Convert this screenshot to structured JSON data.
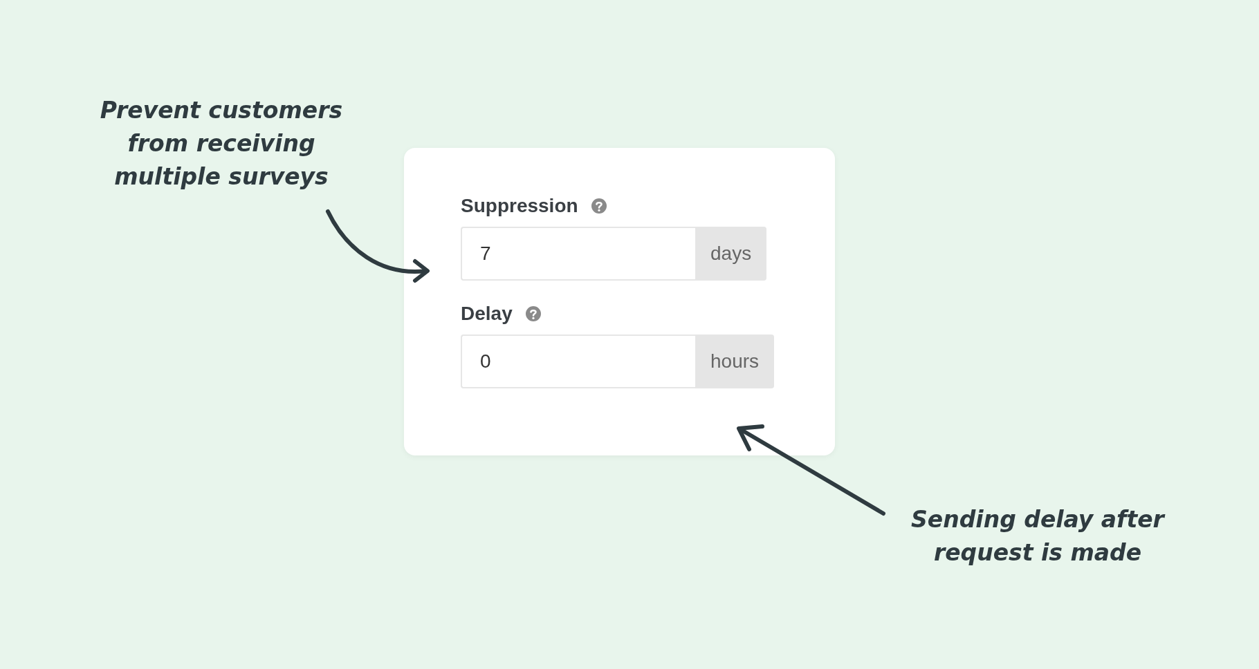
{
  "annotations": [
    {
      "lines": [
        "Prevent customers",
        "from receiving",
        "multiple surveys"
      ]
    },
    {
      "lines": [
        "Sending delay after",
        "request is made"
      ]
    }
  ],
  "fields": [
    {
      "label": "Suppression",
      "value": "7",
      "unit": "days"
    },
    {
      "label": "Delay",
      "value": "0",
      "unit": "hours"
    }
  ]
}
